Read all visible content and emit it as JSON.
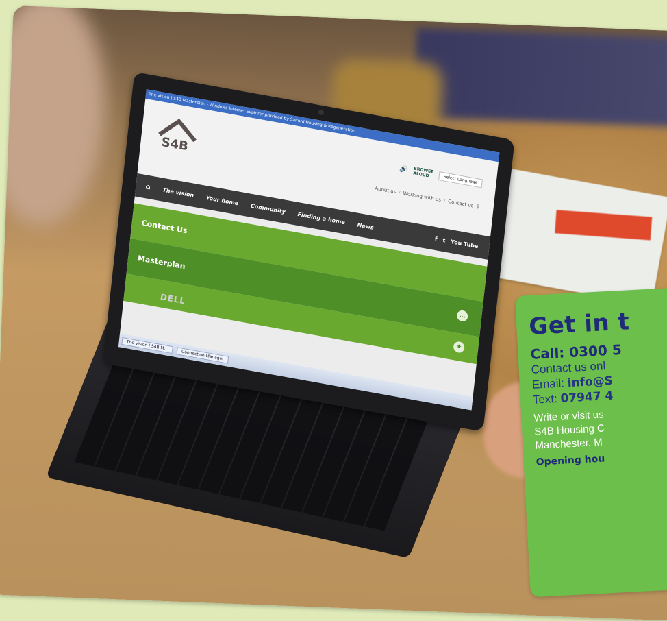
{
  "screen": {
    "browser_title": "The vision | S4B Masterplan - Windows Internet Explorer provided by Salford Housing & Regeneration",
    "logo": "S4B",
    "utility": {
      "speaker": "🔊",
      "browsealoud_top": "BROWSE",
      "browsealoud_bottom": "ALOUD",
      "language": "Select Language"
    },
    "top_links": [
      "About us",
      "/",
      "Working with us",
      "/",
      "Contact us"
    ],
    "nav": [
      "The vision",
      "Your home",
      "Community",
      "Finding a home",
      "News"
    ],
    "social": [
      "f",
      "t",
      "You Tube"
    ],
    "panels": {
      "contact": "Contact Us",
      "masterplan": "Masterplan"
    },
    "taskbar": [
      "The vision | S4B M...",
      "Connection Manager"
    ],
    "brand": "DELL"
  },
  "contact_box": {
    "title": "Get in t",
    "call": "Call: 0300 5",
    "online": "Contact us onl",
    "email_label": "Email: ",
    "email_value": "info@S",
    "text_label": "Text: ",
    "text_value": "07947 4",
    "write": "Write or visit us",
    "address1": "S4B Housing C",
    "address2": "Manchester. M",
    "hours": "Opening hou"
  },
  "colors": {
    "background": "#dfeab8",
    "green_panel": "#6cbf4a",
    "navy_text": "#1f2a78",
    "site_green": "#6aa92f"
  }
}
